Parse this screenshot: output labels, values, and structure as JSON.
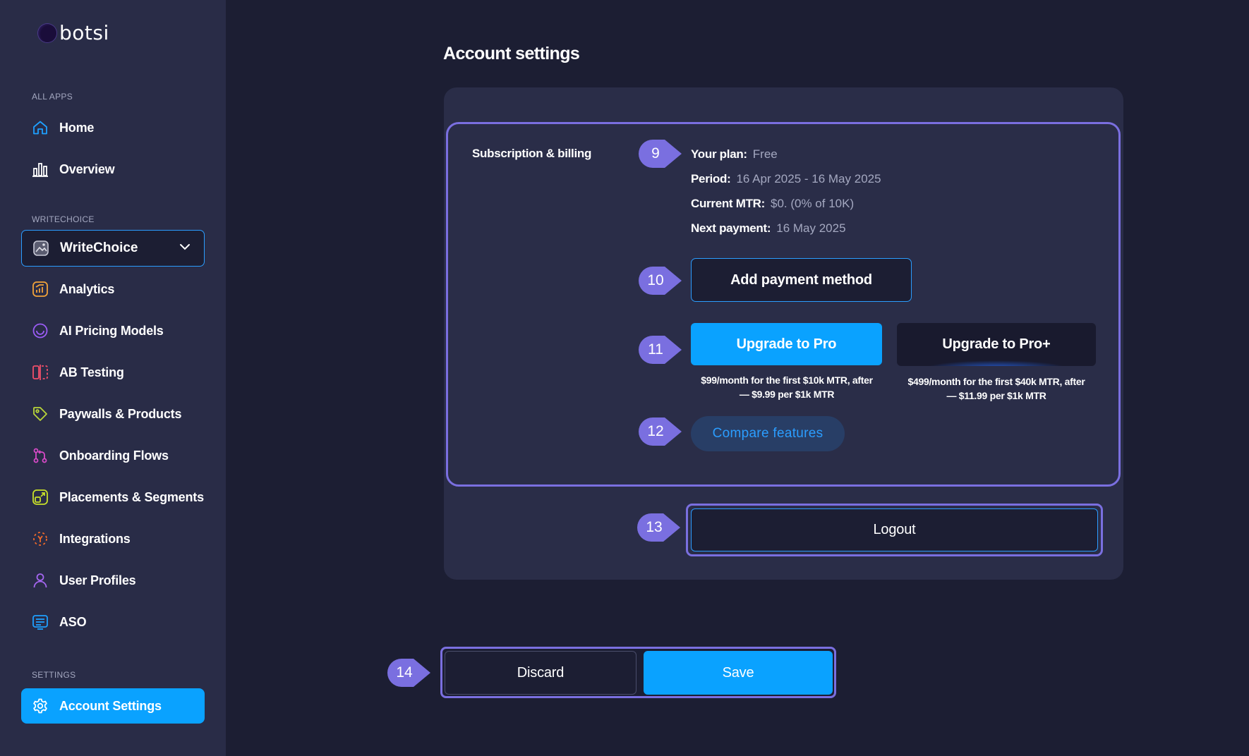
{
  "brand": {
    "name": "botsi"
  },
  "sidebar": {
    "sections": {
      "all_apps": "ALL APPS",
      "writechoice": "WRITECHOICE",
      "settings": "SETTINGS"
    },
    "top_items": [
      {
        "label": "Home",
        "icon": "home-icon"
      },
      {
        "label": "Overview",
        "icon": "bar-chart-icon"
      }
    ],
    "app_selector": {
      "label": "WriteChoice",
      "icon": "app-image-icon"
    },
    "app_items": [
      {
        "label": "Analytics",
        "icon": "analytics-icon",
        "color": "#f2a33a"
      },
      {
        "label": "AI Pricing Models",
        "icon": "ai-circle-icon",
        "color": "#9b5cf6"
      },
      {
        "label": "AB Testing",
        "icon": "ab-testing-icon",
        "color": "#ef4f6a"
      },
      {
        "label": "Paywalls & Products",
        "icon": "tag-icon",
        "color": "#b9d63a"
      },
      {
        "label": "Onboarding Flows",
        "icon": "flow-icon",
        "color": "#d84ac8"
      },
      {
        "label": "Placements & Segments",
        "icon": "placement-icon",
        "color": "#c8e02a"
      },
      {
        "label": "Integrations",
        "icon": "integrations-icon",
        "color": "#f06a2a"
      },
      {
        "label": "User Profiles",
        "icon": "user-icon",
        "color": "#a466f0"
      },
      {
        "label": "ASO",
        "icon": "aso-icon",
        "color": "#1ea0ff"
      }
    ],
    "settings_item": {
      "label": "Account Settings",
      "icon": "gear-icon"
    }
  },
  "main": {
    "title": "Account settings",
    "billing": {
      "section_title": "Subscription & billing",
      "rows": [
        {
          "key": "Your plan:",
          "value": "Free"
        },
        {
          "key": "Period:",
          "value": "16 Apr 2025 - 16 May 2025"
        },
        {
          "key": "Current MTR:",
          "value": "$0. (0% of 10K)"
        },
        {
          "key": "Next payment:",
          "value": "16 May 2025"
        }
      ],
      "add_payment_label": "Add payment method",
      "upgrade_pro_label": "Upgrade to Pro",
      "upgrade_pro_note_1": "$99/month for the first $10k MTR, after",
      "upgrade_pro_note_2": "— $9.99 per $1k MTR",
      "upgrade_proplus_label": "Upgrade to Pro+",
      "upgrade_proplus_note_1": "$499/month for the first $40k MTR, after",
      "upgrade_proplus_note_2": "— $11.99 per $1k MTR",
      "compare_label": "Compare features"
    },
    "logout_label": "Logout",
    "footer": {
      "discard_label": "Discard",
      "save_label": "Save"
    }
  },
  "annotations": [
    "9",
    "10",
    "11",
    "12",
    "13",
    "14"
  ],
  "colors": {
    "accent": "#0aa2ff",
    "annotation": "#7a6fe0",
    "sidebar_bg": "#292c47",
    "page_bg": "#1c1e33"
  }
}
